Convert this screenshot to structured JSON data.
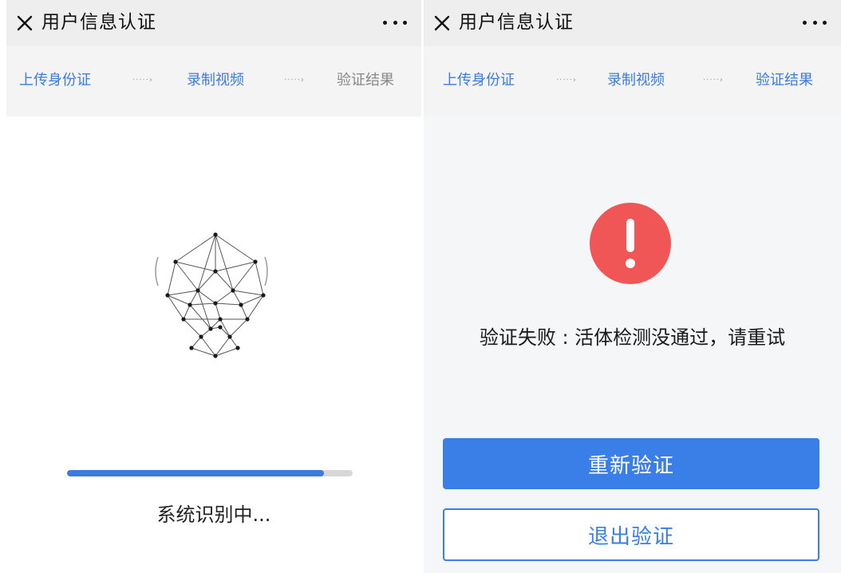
{
  "app": {
    "title": "用户信息认证"
  },
  "steps": [
    {
      "label": "上传身份证",
      "state": "done"
    },
    {
      "label": "录制视频",
      "state": "done"
    },
    {
      "label": "验证结果",
      "state": "pending"
    }
  ],
  "step_arrow": "·····›",
  "icons": {
    "close": "close-icon",
    "more": "more-dots-icon",
    "face": "face-scan-icon",
    "alert": "exclamation-alert-icon"
  },
  "left_screen": {
    "progress": 0.9,
    "status_text": "系统识别中..."
  },
  "right_screen": {
    "steps_state": [
      "done",
      "done",
      "done"
    ],
    "result_message": "验证失败 : 活体检测没通过，请重试",
    "retry_button": "重新验证",
    "exit_button": "退出验证"
  },
  "colors": {
    "accent": "#3a7ee8",
    "error": "#f15656",
    "inactive_text": "#888888"
  }
}
